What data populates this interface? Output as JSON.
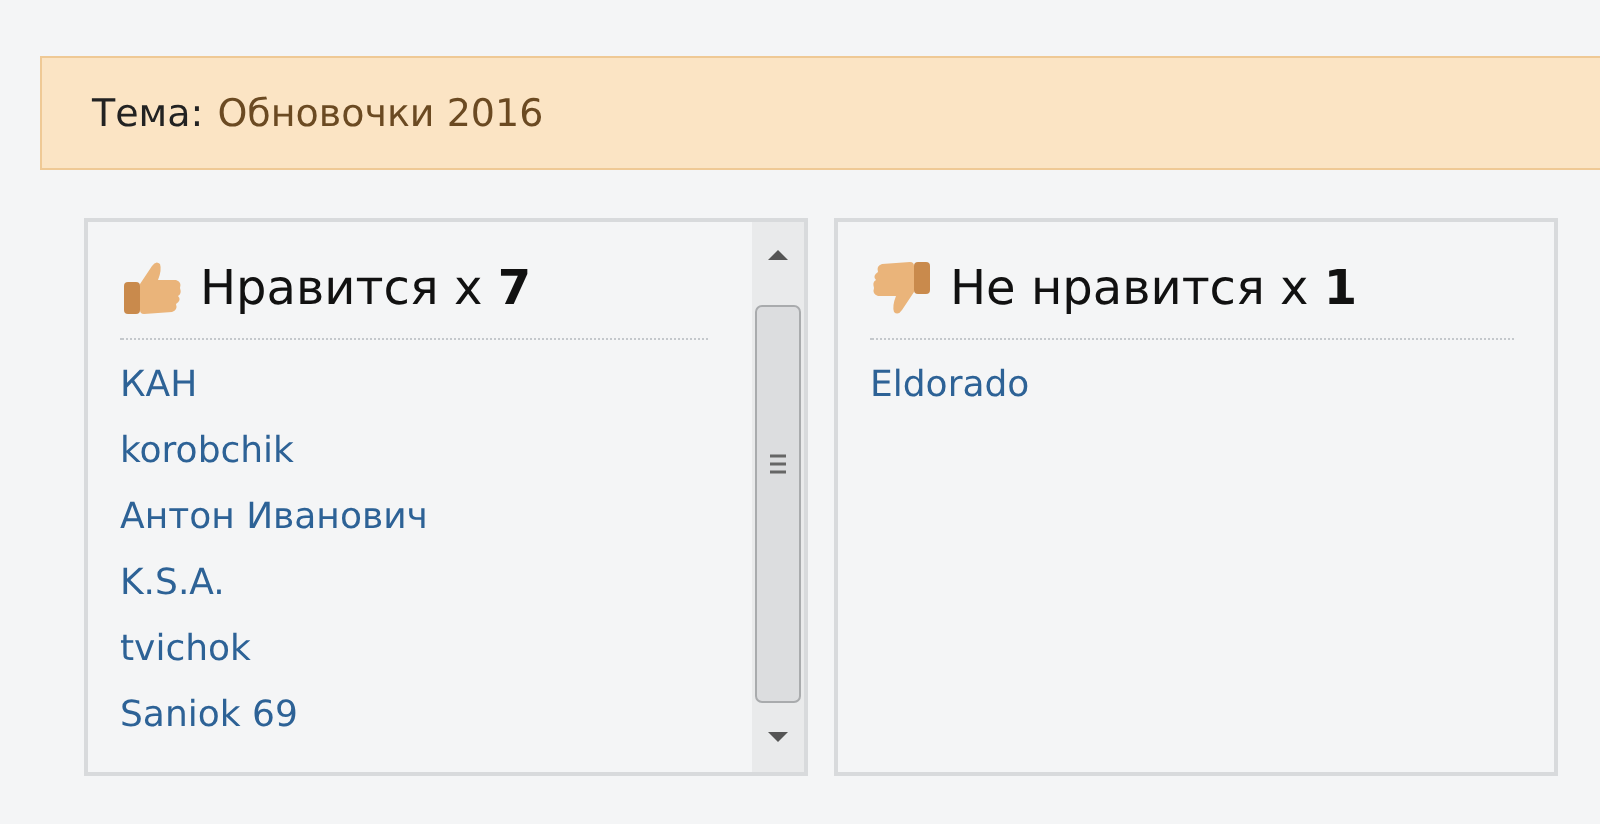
{
  "topic": {
    "label": "Тема:",
    "title": "Обновочки 2016"
  },
  "panels": [
    {
      "kind": "like",
      "heading": "Нравится x **7**",
      "scrollbar": true,
      "users": [
        "КАН",
        "korobchik",
        "Антон Иванович",
        "K.S.A.",
        "tvichok",
        "Saniok 69"
      ]
    },
    {
      "kind": "dislike",
      "heading": "Не нравится x **1**",
      "scrollbar": false,
      "users": [
        "Eldorado"
      ]
    }
  ]
}
